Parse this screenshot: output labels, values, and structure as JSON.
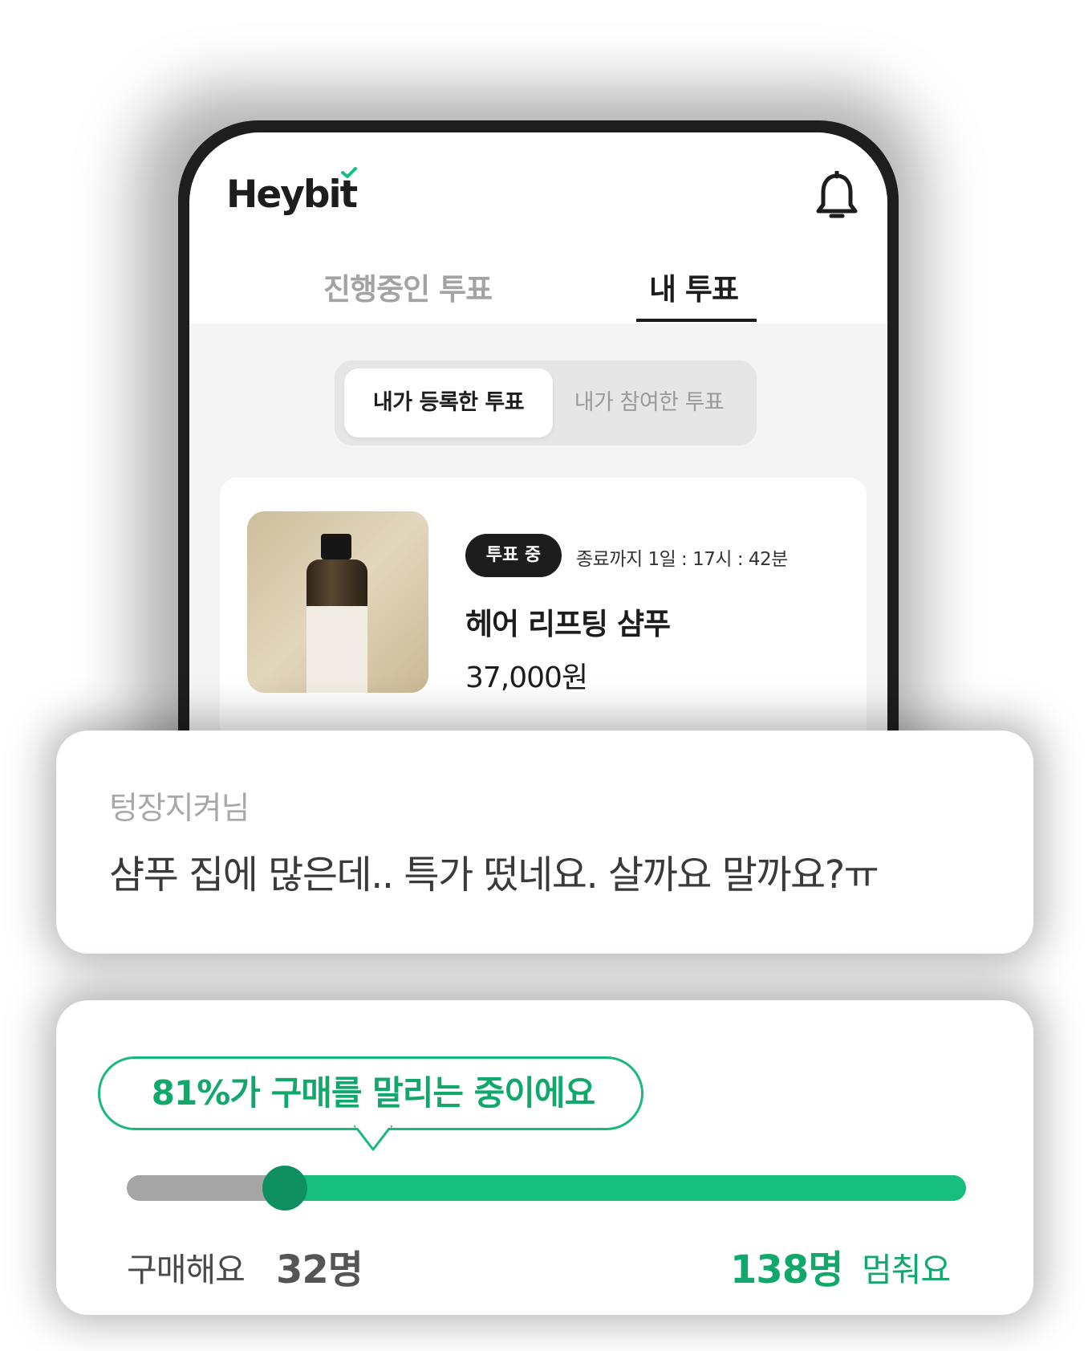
{
  "app": {
    "logo_text": "Heybit",
    "accent_color": "#17bf7e"
  },
  "header": {
    "notification_icon": "bell-icon"
  },
  "tabs": [
    {
      "label": "진행중인 투표",
      "active": false
    },
    {
      "label": "내 투표",
      "active": true
    }
  ],
  "segment": {
    "items": [
      {
        "label": "내가 등록한 투표",
        "active": true
      },
      {
        "label": "내가 참여한 투표",
        "active": false
      }
    ]
  },
  "product": {
    "status_badge": "투표 중",
    "time_left": "종료까지 1일 : 17시 : 42분",
    "name": "헤어 리프팅 샴푸",
    "price": "37,000원"
  },
  "comment": {
    "user": "텅장지켜님",
    "text": "샴푸 집에 많은데.. 특가 떴네요. 살까요 말까요?ㅠ"
  },
  "vote": {
    "bubble_text": "81%가 구매를 말리는 중이에요",
    "buy_label": "구매해요",
    "buy_count": "32명",
    "stop_count": "138명",
    "stop_label": "멈춰요",
    "buy_votes": 32,
    "stop_votes": 138,
    "stop_percent": 81
  }
}
